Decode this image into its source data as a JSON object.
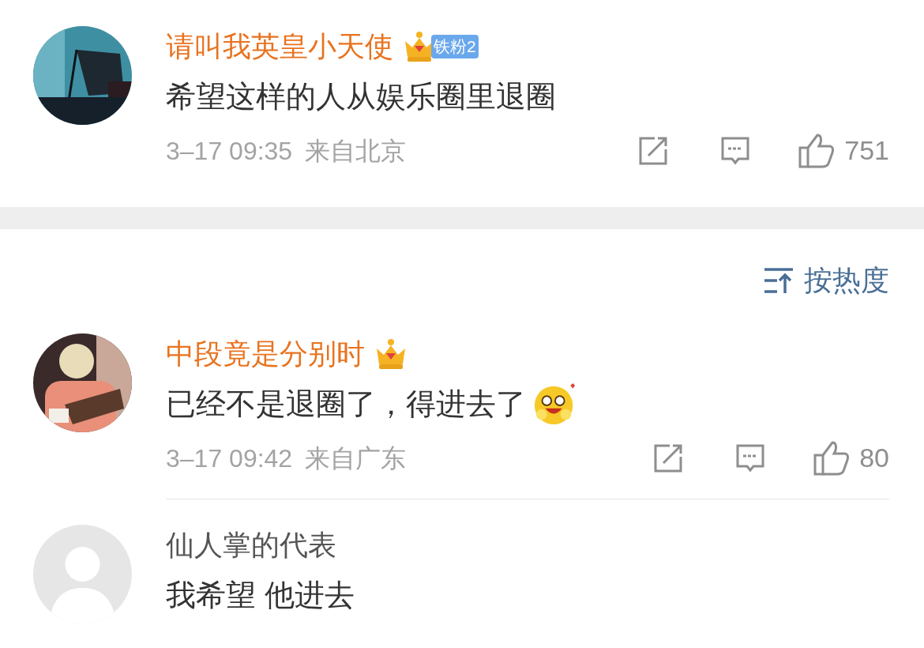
{
  "top_comments": [
    {
      "name": "请叫我英皇小天使",
      "vip": true,
      "fan_badge": "铁粉2",
      "text": "希望这样的人从娱乐圈里退圈",
      "emoji": false,
      "time": "3–17 09:35",
      "location": "来自北京",
      "likes": "751"
    }
  ],
  "sort": {
    "label": "按热度"
  },
  "comments": [
    {
      "name": "中段竟是分别时",
      "vip": true,
      "text": "已经不是退圈了，得进去了",
      "emoji": true,
      "time": "3–17 09:42",
      "location": "来自广东",
      "likes": "80"
    },
    {
      "avatar": {
        "kind": "default"
      },
      "name": "仙人掌的代表",
      "vip": false,
      "text": "我希望 他进去",
      "emoji": false
    }
  ]
}
